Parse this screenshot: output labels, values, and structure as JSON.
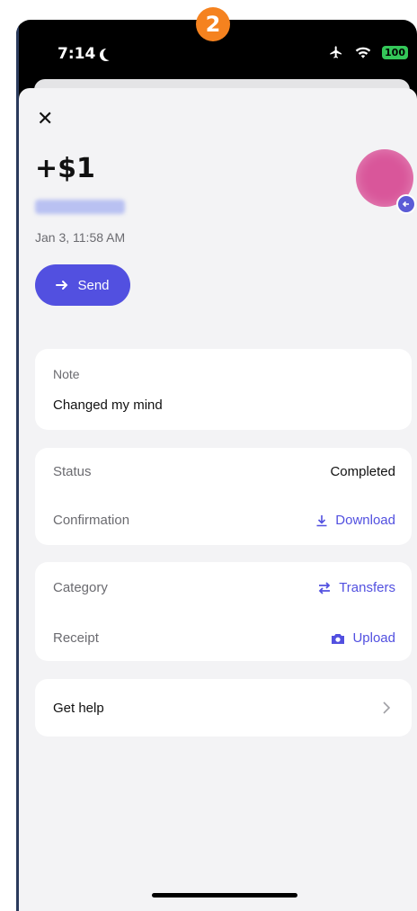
{
  "overlay": {
    "step": "2"
  },
  "status_bar": {
    "time": "7:14",
    "battery": "100"
  },
  "header": {
    "close_icon": "close-icon"
  },
  "transaction": {
    "amount": "+$1",
    "date": "Jan 3, 11:58 AM",
    "send_label": "Send"
  },
  "note": {
    "label": "Note",
    "value": "Changed my mind"
  },
  "details": {
    "status_label": "Status",
    "status_value": "Completed",
    "confirmation_label": "Confirmation",
    "download_label": "Download"
  },
  "meta": {
    "category_label": "Category",
    "category_value": "Transfers",
    "receipt_label": "Receipt",
    "upload_label": "Upload"
  },
  "help": {
    "label": "Get help"
  },
  "colors": {
    "accent": "#5250e0",
    "badge": "#f5821f",
    "avatar": "#d9569a"
  }
}
